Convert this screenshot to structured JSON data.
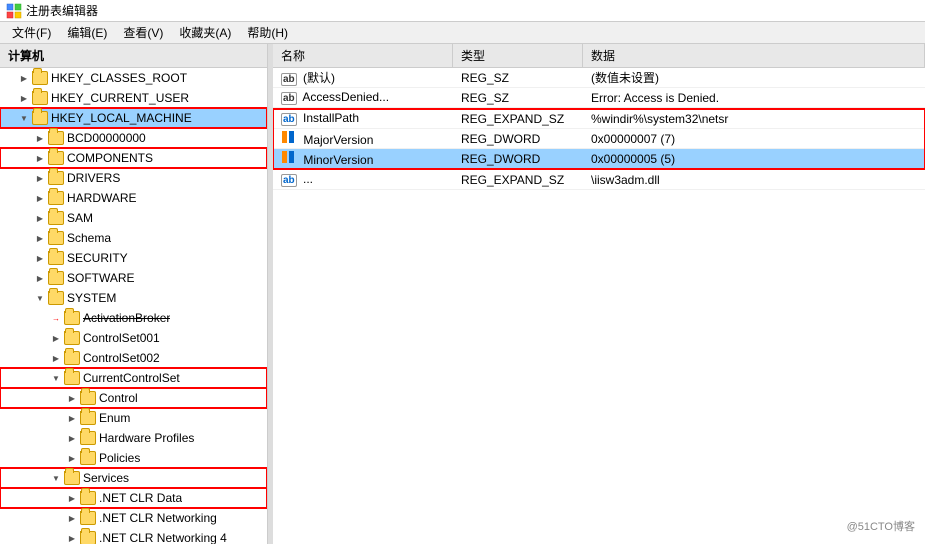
{
  "titleBar": {
    "icon": "registry-editor-icon",
    "title": "注册表编辑器"
  },
  "menuBar": {
    "items": [
      "文件(F)",
      "编辑(E)",
      "查看(V)",
      "收藏夹(A)",
      "帮助(H)"
    ]
  },
  "treePanel": {
    "header": "计算机",
    "nodes": [
      {
        "id": "computer",
        "label": "计算机",
        "indent": 0,
        "expanded": true,
        "type": "root"
      },
      {
        "id": "hkcr",
        "label": "HKEY_CLASSES_ROOT",
        "indent": 1,
        "expanded": false,
        "type": "hive"
      },
      {
        "id": "hkcu",
        "label": "HKEY_CURRENT_USER",
        "indent": 1,
        "expanded": false,
        "type": "hive"
      },
      {
        "id": "hklm",
        "label": "HKEY_LOCAL_MACHINE",
        "indent": 1,
        "expanded": true,
        "type": "hive",
        "selected": true,
        "highlighted": true
      },
      {
        "id": "bcd",
        "label": "BCD00000000",
        "indent": 2,
        "expanded": false,
        "type": "folder"
      },
      {
        "id": "components",
        "label": "COMPONENTS",
        "indent": 2,
        "expanded": false,
        "type": "folder",
        "highlighted": true
      },
      {
        "id": "drivers",
        "label": "DRIVERS",
        "indent": 2,
        "expanded": false,
        "type": "folder"
      },
      {
        "id": "hardware",
        "label": "HARDWARE",
        "indent": 2,
        "expanded": false,
        "type": "folder"
      },
      {
        "id": "sam",
        "label": "SAM",
        "indent": 2,
        "expanded": false,
        "type": "folder"
      },
      {
        "id": "schema",
        "label": "Schema",
        "indent": 2,
        "expanded": false,
        "type": "folder"
      },
      {
        "id": "security",
        "label": "SECURITY",
        "indent": 2,
        "expanded": false,
        "type": "folder"
      },
      {
        "id": "software",
        "label": "SOFTWARE",
        "indent": 2,
        "expanded": false,
        "type": "folder"
      },
      {
        "id": "system",
        "label": "SYSTEM",
        "indent": 2,
        "expanded": true,
        "type": "folder"
      },
      {
        "id": "activationbroker",
        "label": "ActivationBroker",
        "indent": 3,
        "expanded": false,
        "type": "folder",
        "strikethrough": true
      },
      {
        "id": "controlset001",
        "label": "ControlSet001",
        "indent": 3,
        "expanded": false,
        "type": "folder"
      },
      {
        "id": "controlset002",
        "label": "ControlSet002",
        "indent": 3,
        "expanded": false,
        "type": "folder"
      },
      {
        "id": "currentcontrolset",
        "label": "CurrentControlSet",
        "indent": 3,
        "expanded": true,
        "type": "folder",
        "highlighted": true
      },
      {
        "id": "control",
        "label": "Control",
        "indent": 4,
        "expanded": false,
        "type": "folder",
        "highlighted": true
      },
      {
        "id": "enum",
        "label": "Enum",
        "indent": 4,
        "expanded": false,
        "type": "folder"
      },
      {
        "id": "hwprofiles",
        "label": "Hardware Profiles",
        "indent": 4,
        "expanded": false,
        "type": "folder"
      },
      {
        "id": "policies",
        "label": "Policies",
        "indent": 4,
        "expanded": false,
        "type": "folder"
      },
      {
        "id": "services",
        "label": "Services",
        "indent": 3,
        "expanded": true,
        "type": "folder",
        "highlighted": true
      },
      {
        "id": "netclr",
        "label": ".NET CLR Data",
        "indent": 4,
        "expanded": false,
        "type": "folder",
        "highlighted": true
      },
      {
        "id": "netclrnet",
        "label": ".NET CLR Networking",
        "indent": 4,
        "expanded": false,
        "type": "folder"
      },
      {
        "id": "netclrnet4",
        "label": ".NET CLR Networking 4",
        "indent": 4,
        "expanded": false,
        "type": "folder"
      }
    ]
  },
  "dataPanel": {
    "columns": [
      "名称",
      "类型",
      "数据"
    ],
    "rows": [
      {
        "name": "(默认)",
        "nameIcon": "ab",
        "type": "REG_SZ",
        "data": "(数值未设置)",
        "selected": false
      },
      {
        "name": "AccessDenied...",
        "nameIcon": "ab",
        "type": "REG_SZ",
        "data": "Error: Access is Denied.",
        "selected": false
      },
      {
        "name": "InstallPath",
        "nameIcon": "ab",
        "type": "REG_EXPAND_SZ",
        "data": "%windir%\\system32\\netsr",
        "selected": false,
        "highlighted": true
      },
      {
        "name": "MajorVersion",
        "nameIcon": "bin",
        "type": "REG_DWORD",
        "data": "0x00000007 (7)",
        "selected": false,
        "highlighted": true
      },
      {
        "name": "MinorVersion",
        "nameIcon": "bin",
        "type": "REG_DWORD",
        "data": "0x00000005 (5)",
        "selected": true,
        "highlighted": true
      },
      {
        "name": "...",
        "nameIcon": "ab",
        "type": "REG_EXPAND_SZ",
        "data": "\\iisw3adm.dll",
        "selected": false
      }
    ]
  },
  "watermark": "@51CTO博客"
}
